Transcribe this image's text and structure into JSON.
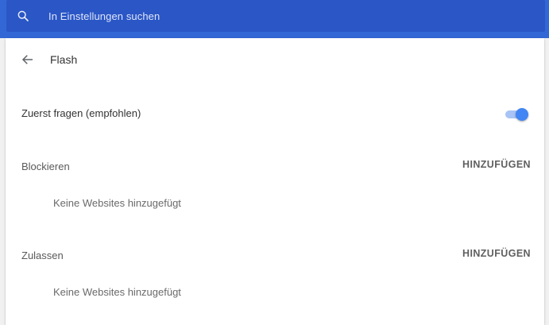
{
  "search": {
    "placeholder": "In Einstellungen suchen",
    "icon": "search-icon"
  },
  "header": {
    "back_icon": "arrow-back-icon",
    "title": "Flash"
  },
  "ask_first": {
    "label": "Zuerst fragen (empfohlen)",
    "enabled": true,
    "accent_color": "#4285f4"
  },
  "sections": [
    {
      "title": "Blockieren",
      "action_label": "HINZUFÜGEN",
      "empty_text": "Keine Websites hinzugefügt"
    },
    {
      "title": "Zulassen",
      "action_label": "HINZUFÜGEN",
      "empty_text": "Keine Websites hinzugefügt"
    }
  ],
  "colors": {
    "topbar": "#3367d6",
    "search_box": "#2a56c6"
  }
}
